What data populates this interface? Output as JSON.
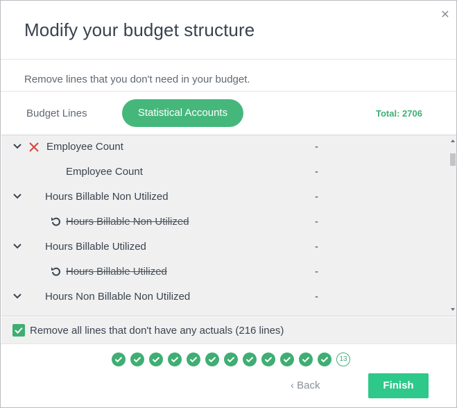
{
  "dialog": {
    "title": "Modify your budget structure",
    "subtitle": "Remove lines that you don't need in your budget."
  },
  "tabs": {
    "budget_lines": "Budget Lines",
    "statistical_accounts": "Statistical Accounts",
    "total": "Total: 2706"
  },
  "rows": [
    {
      "label": "Employee Count",
      "value": "-"
    },
    {
      "label": "Employee Count",
      "value": "-"
    },
    {
      "label": "Hours Billable Non Utilized",
      "value": "-"
    },
    {
      "label": "Hours Billable Non Utilized",
      "value": "-"
    },
    {
      "label": "Hours Billable Utilized",
      "value": "-"
    },
    {
      "label": "Hours Billable Utilized",
      "value": "-"
    },
    {
      "label": "Hours Non Billable Non Utilized",
      "value": "-"
    }
  ],
  "options": {
    "remove_no_actuals": "Remove all lines that don't have any actuals (216 lines)"
  },
  "stepper": {
    "current_step": "13"
  },
  "footer": {
    "back": "Back",
    "finish": "Finish"
  },
  "colors": {
    "accent": "#46b77b",
    "finish": "#2ec88a",
    "remove": "#d9413b"
  }
}
